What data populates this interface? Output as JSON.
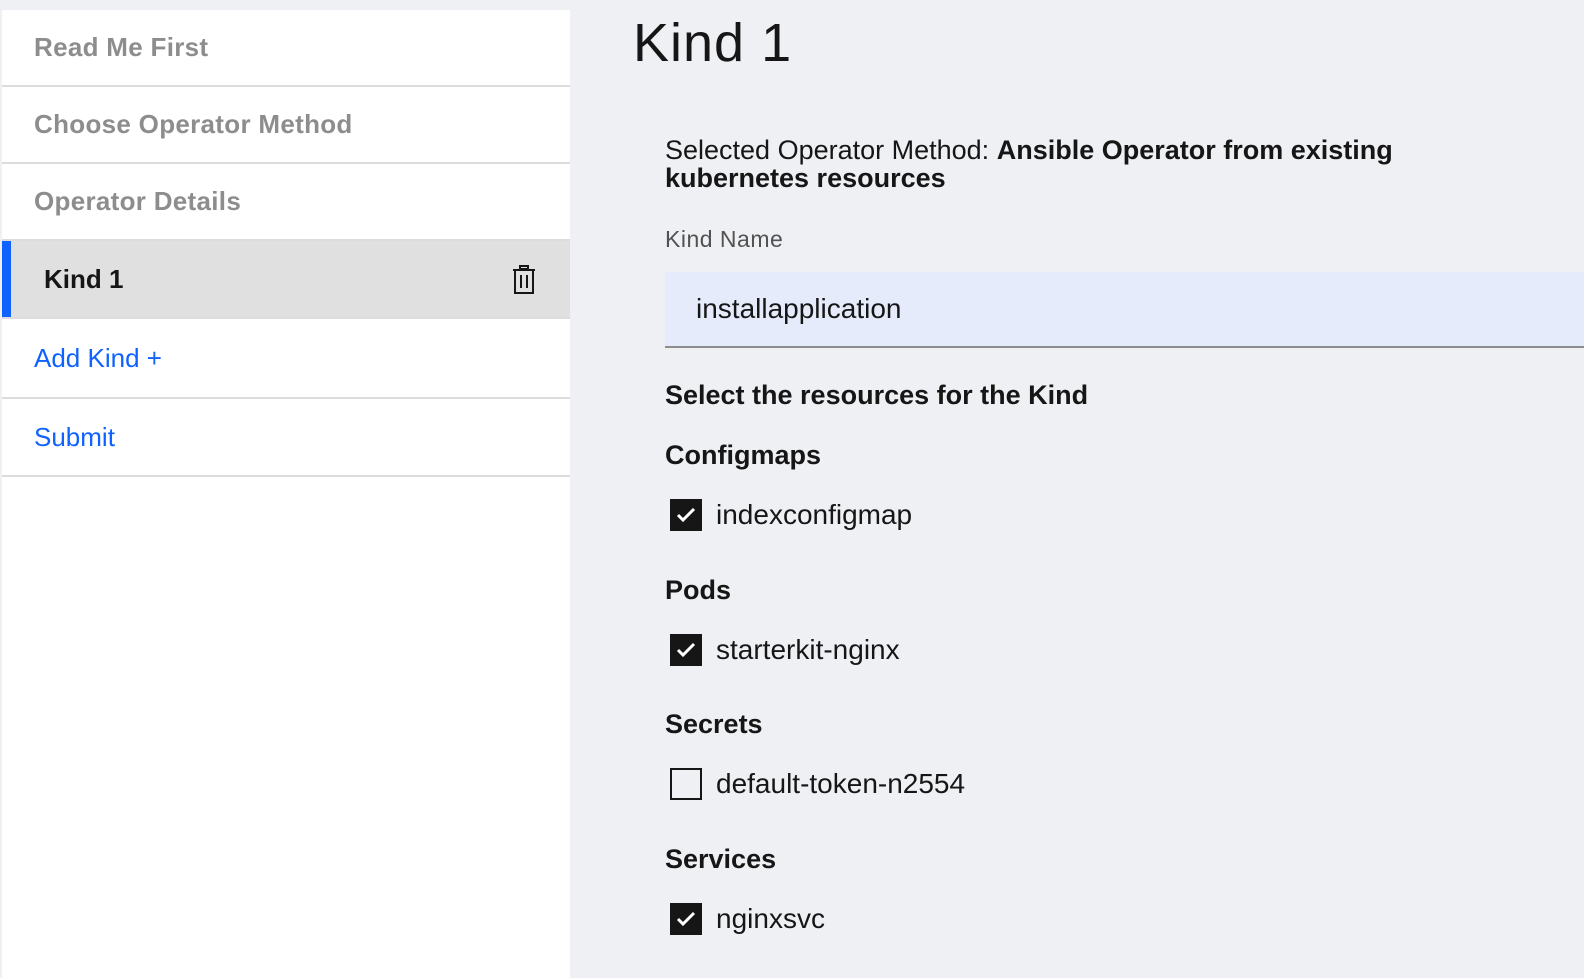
{
  "sidebar": {
    "steps": [
      {
        "label": "Read Me First"
      },
      {
        "label": "Choose Operator Method"
      },
      {
        "label": "Operator Details"
      }
    ],
    "active_kind": {
      "label": "Kind 1",
      "icon": "trash-icon"
    },
    "add_kind_label": "Add Kind +",
    "submit_label": "Submit"
  },
  "main": {
    "title": "Kind 1",
    "method_prefix": "Selected Operator Method:",
    "method_value": "Ansible Operator from existing kubernetes resources",
    "kind_name_label": "Kind Name",
    "kind_name_value": "installapplication",
    "resources_heading": "Select the resources for the Kind",
    "groups": [
      {
        "title": "Configmaps",
        "items": [
          {
            "label": "indexconfigmap",
            "checked": true
          }
        ]
      },
      {
        "title": "Pods",
        "items": [
          {
            "label": "starterkit-nginx",
            "checked": true
          }
        ]
      },
      {
        "title": "Secrets",
        "items": [
          {
            "label": "default-token-n2554",
            "checked": false
          }
        ]
      },
      {
        "title": "Services",
        "items": [
          {
            "label": "nginxsvc",
            "checked": true
          }
        ]
      }
    ]
  },
  "colors": {
    "accent": "#0f62fe",
    "page_bg": "#eff0f4",
    "input_bg": "#e5ebfa",
    "active_item_bg": "#e0e0e0"
  }
}
